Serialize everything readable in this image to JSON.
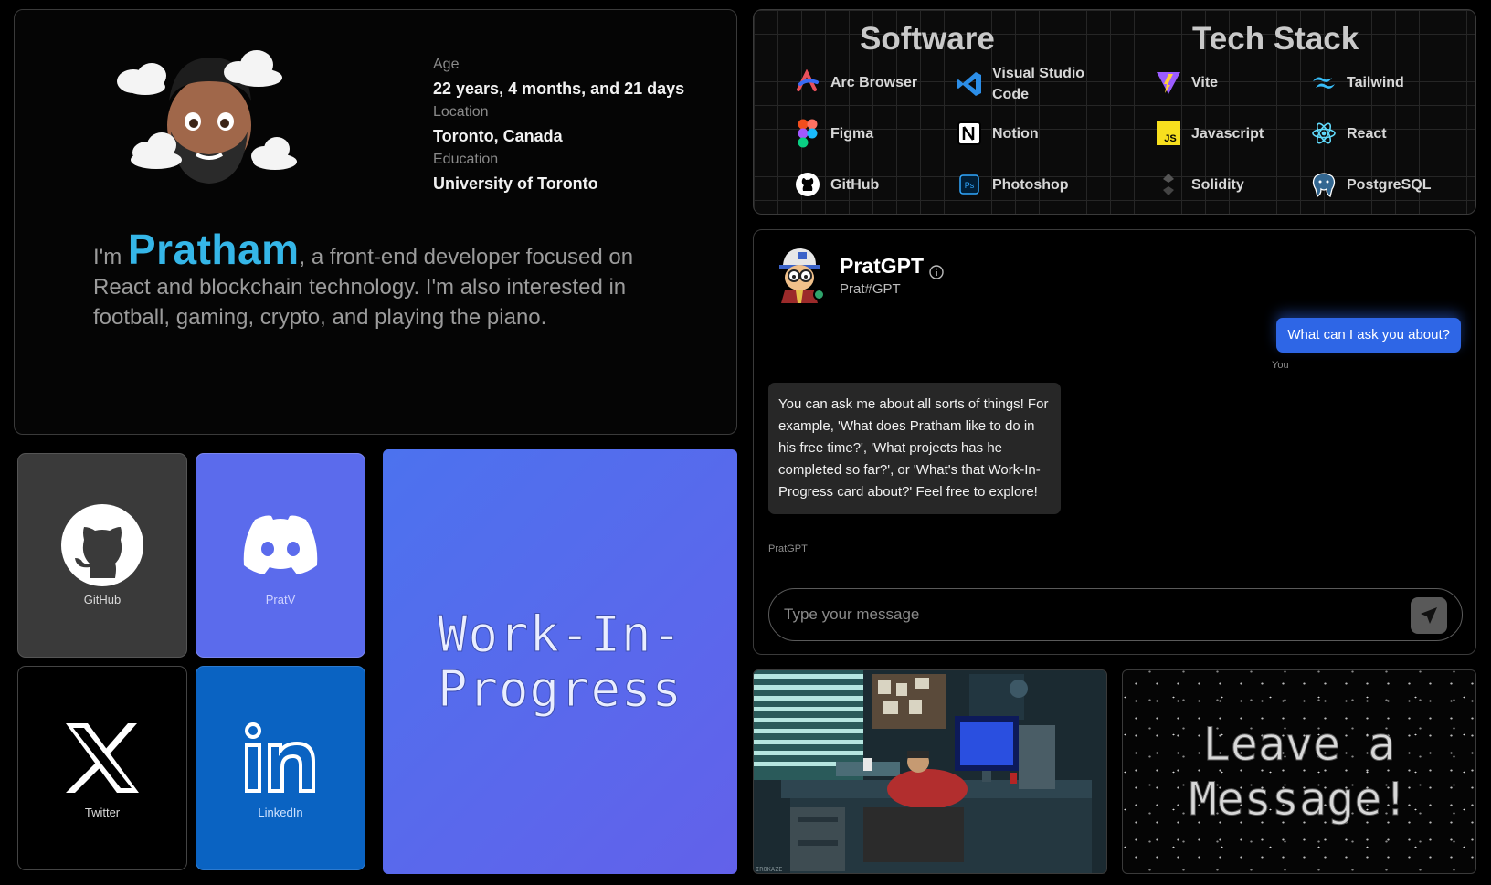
{
  "profile": {
    "age_label": "Age",
    "age_value": "22 years, 4 months, and 21 days",
    "location_label": "Location",
    "location_value": "Toronto, Canada",
    "education_label": "Education",
    "education_value": "University of Toronto",
    "bio_prefix": "I'm ",
    "name": "Pratham",
    "bio_rest": ", a front-end developer focused on React and blockchain technology. I'm also interested in football, gaming, crypto, and playing the piano."
  },
  "stack": {
    "software_heading": "Software",
    "tech_heading": "Tech Stack",
    "software": [
      {
        "label": "Arc Browser",
        "icon": "arc-browser-icon"
      },
      {
        "label": "Visual Studio Code",
        "icon": "vscode-icon"
      },
      {
        "label": "Figma",
        "icon": "figma-icon"
      },
      {
        "label": "Notion",
        "icon": "notion-icon"
      },
      {
        "label": "GitHub",
        "icon": "github-icon"
      },
      {
        "label": "Photoshop",
        "icon": "photoshop-icon"
      }
    ],
    "tech": [
      {
        "label": "Vite",
        "icon": "vite-icon"
      },
      {
        "label": "Tailwind",
        "icon": "tailwind-icon"
      },
      {
        "label": "Javascript",
        "icon": "javascript-icon"
      },
      {
        "label": "React",
        "icon": "react-icon"
      },
      {
        "label": "Solidity",
        "icon": "solidity-icon"
      },
      {
        "label": "PostgreSQL",
        "icon": "postgresql-icon"
      }
    ]
  },
  "chat": {
    "bot_name": "PratGPT",
    "bot_handle": "Prat#GPT",
    "user_message": "What can I ask you about?",
    "user_meta": "You",
    "bot_message": "You can ask me about all sorts of things! For example, 'What does Pratham like to do in his free time?', 'What projects has he completed so far?', or 'What's that Work-In-Progress card about?' Feel free to explore!",
    "bot_meta": "PratGPT",
    "input_placeholder": "Type your message",
    "input_value": ""
  },
  "socials": {
    "github": "GitHub",
    "discord": "PratV",
    "twitter": "Twitter",
    "linkedin": "LinkedIn"
  },
  "wip": {
    "line1": "Work-In-",
    "line2": "Progress"
  },
  "room": {
    "signature": "IROKAZE"
  },
  "leave": {
    "line1": "Leave a",
    "line2": "Message!"
  },
  "colors": {
    "name_accent": "#35b6e8",
    "user_bubble": "#2e66e6",
    "discord": "#5b6bec",
    "linkedin": "#0a63c2",
    "wip": "#5a68ec",
    "online": "#2fa36b"
  }
}
